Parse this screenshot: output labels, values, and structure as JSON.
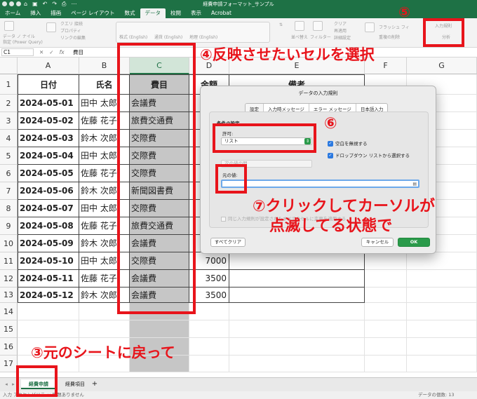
{
  "window": {
    "title": "経費申請フォーマット_サンプル",
    "qa_icons": [
      "home-icon",
      "save-icon",
      "undo-icon",
      "redo-icon",
      "print-icon",
      "more-icon"
    ]
  },
  "tabs": [
    "ホーム",
    "挿入",
    "描画",
    "ページ レイアウト",
    "数式",
    "データ",
    "校閲",
    "表示",
    "Acrobat"
  ],
  "active_tab": "データ",
  "ribbon": {
    "get_data_label1": "データ ノ ナイル",
    "get_data_label2": "指定 (Power Query)",
    "refresh_items": [
      "クエリ 接続",
      "プロパティ",
      "リンクの編集"
    ],
    "stocks": "株式 (English)",
    "currencies": "通貨 (English)",
    "geo": "地理 (English)",
    "sort_label": "並べ替え",
    "filter_label": "フィルター",
    "clear": "クリア",
    "reapply": "再適用",
    "advanced": "詳細設定",
    "flash_fill": "フラッシュ フィ",
    "remove_dup": "重複の削除",
    "validation_label": "入力規則",
    "analysis": "分析"
  },
  "formula_bar": {
    "cell": "C1",
    "fx": "fx",
    "value": "費目"
  },
  "columns": [
    "A",
    "B",
    "C",
    "D",
    "E",
    "F",
    "G"
  ],
  "selected_column": "C",
  "rows": [
    "1",
    "2",
    "3",
    "4",
    "5",
    "6",
    "7",
    "8",
    "9",
    "10",
    "11",
    "12",
    "13",
    "14",
    "15",
    "16",
    "17"
  ],
  "table": {
    "headers": [
      "日付",
      "氏名",
      "費目",
      "金額",
      "備考"
    ],
    "data": [
      [
        "2024-05-01",
        "田中 太郎",
        "会議費",
        ""
      ],
      [
        "2024-05-02",
        "佐藤 花子",
        "旅費交通費",
        ""
      ],
      [
        "2024-05-03",
        "鈴木 次郎",
        "交際費",
        ""
      ],
      [
        "2024-05-04",
        "田中 太郎",
        "交際費",
        ""
      ],
      [
        "2024-05-05",
        "佐藤 花子",
        "交際費",
        ""
      ],
      [
        "2024-05-06",
        "鈴木 次郎",
        "新聞図書費",
        ""
      ],
      [
        "2024-05-07",
        "田中 太郎",
        "交際費",
        ""
      ],
      [
        "2024-05-08",
        "佐藤 花子",
        "旅費交通費",
        ""
      ],
      [
        "2024-05-09",
        "鈴木 次郎",
        "会議費",
        ""
      ],
      [
        "2024-05-10",
        "田中 太郎",
        "交際費",
        "7000"
      ],
      [
        "2024-05-11",
        "佐藤 花子",
        "会議費",
        "3500"
      ],
      [
        "2024-05-12",
        "鈴木 次郎",
        "会議費",
        "3500"
      ]
    ]
  },
  "dialog": {
    "title": "データの入力規則",
    "tabs": [
      "設定",
      "入力時メッセージ",
      "エラー メッセージ",
      "日本語入力"
    ],
    "criteria": "条件の設定",
    "allow_label": "許可:",
    "allow_value": "リスト",
    "ignore_blank": "空白を無視する",
    "in_cell_dropdown": "ドロップダウン リストから選択する",
    "data_value": "次の値の間",
    "source_label": "元の値:",
    "apply_all": "同じ入力規則が設定されたすべてのセルに変更を適用する",
    "clear_all": "すべてクリア",
    "cancel": "キャンセル",
    "ok": "OK"
  },
  "annotations": {
    "a3": "③元のシートに戻って",
    "a4": "④反映させたいセルを選択",
    "a5": "⑤",
    "a6": "⑥",
    "a7_line1": "⑦クリックしてカーソルが",
    "a7_line2": "点滅してる状態で"
  },
  "sheet_tabs": [
    "経費申請",
    "経費項目"
  ],
  "add_sheet": "+",
  "status": {
    "left": "入力 アクセシビリティ: 問題ありません",
    "right": "データの個数: 13"
  },
  "colors": {
    "excel_green": "#1e7145",
    "annotation_red": "#e8141b",
    "selected_cells": "#c6c6c6",
    "ok_button": "#2a9a4a"
  }
}
